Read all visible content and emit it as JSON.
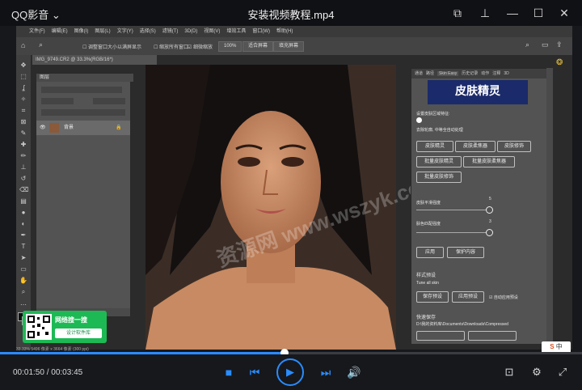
{
  "player": {
    "app_name": "QQ影音",
    "file_title": "安装视频教程.mp4",
    "time_current": "00:01:50",
    "time_separator": " / ",
    "time_total": "00:03:45",
    "progress": 0.489
  },
  "photoshop": {
    "menu": [
      "文件(F)",
      "编辑(E)",
      "图像(I)",
      "图层(L)",
      "文字(Y)",
      "选择(S)",
      "滤镜(T)",
      "3D(D)",
      "视图(V)",
      "增效工具",
      "窗口(W)",
      "帮助(H)"
    ],
    "options": {
      "check1": "调整窗口大小以满屏显示",
      "check2": "缩放所有窗口",
      "check3": "细微缩放",
      "zoom_value": "100%",
      "fit_screen": "适合屏幕",
      "fill_screen": "填充屏幕"
    },
    "doc_tab": "IMG_9749.CR2 @ 33.3%(RGB/16*)",
    "status": "33.33%   5496 像素 x 3664 像素 (300 ppi)",
    "layers_panel": {
      "title": "图层",
      "layer_name": "背景"
    },
    "skin_panel": {
      "tabs": [
        "通道",
        "路径",
        "Skin Easy",
        "历史记录",
        "动作",
        "注释",
        "3D"
      ],
      "banner": "皮肤精灵",
      "hint1": "设置皮肤区域特征:",
      "hint2": "去除轮廓, 中等全自动处理",
      "buttons_row1": [
        "皮肤精灵",
        "皮肤柔焦器",
        "皮肤修饰"
      ],
      "buttons_row2": [
        "批量皮肤精灵",
        "批量皮肤柔焦器"
      ],
      "buttons_row3": [
        "批量皮肤修饰"
      ],
      "slider1_label": "皮肤平滑强度",
      "slider1_value": "5",
      "slider2_label": "肤色匹配强度",
      "slider2_value": "3",
      "apply": "应用",
      "save_content": "保护内容",
      "preset_section": "样式预设",
      "preset_default": "Tune all skin",
      "save_preset": "保存预设",
      "apply_preset": "应用预设",
      "auto_apply": "自动应用预设",
      "quick_save": "快速保存",
      "save_path": "D:\\我的资料库\\Documents\\Downloads\\Compressed"
    }
  },
  "overlay": {
    "qr_title": "网络搜一搜",
    "qr_sub": "设计软件库",
    "watermark": "资源网 www.wszyk.com",
    "badge": "中"
  }
}
